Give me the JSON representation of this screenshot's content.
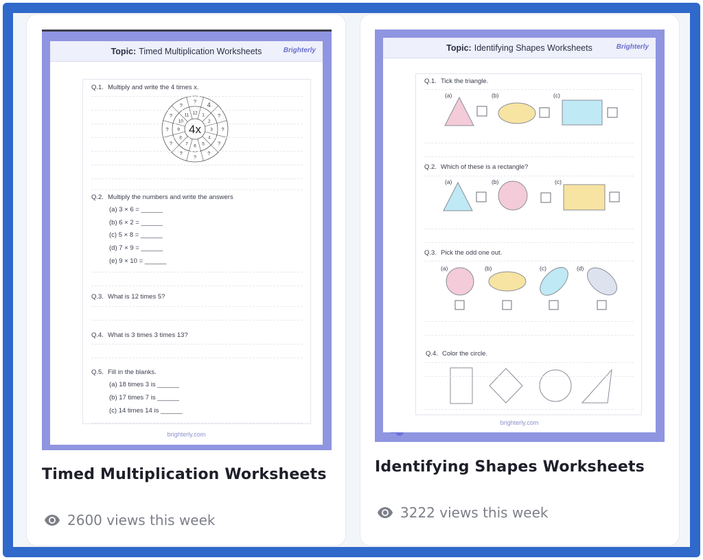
{
  "cards": [
    {
      "title": "Timed Multiplication Worksheets",
      "views": "2600 views this week",
      "sheet": {
        "topic_label": "Topic:",
        "topic": "Timed Multiplication Worksheets",
        "logo": "Brighterly",
        "footer": "brighterly.com",
        "questions": [
          {
            "num": "Q.1.",
            "text": "Multiply and write the 4 times x."
          },
          {
            "num": "Q.2.",
            "text": "Multiply the numbers and write the answers"
          },
          {
            "num": "Q.3.",
            "text": "What is 12 times 5?"
          },
          {
            "num": "Q.4.",
            "text": "What is 3 times 3 times 13?"
          },
          {
            "num": "Q.5.",
            "text": "Fill in the blanks."
          }
        ],
        "q2_items": [
          "(a) 3 × 6 = ______",
          "(b) 6 × 2 = ______",
          "(c) 5 × 8 = ______",
          "(d) 7 × 9 = ______",
          "(e) 9 × 10 = ______"
        ],
        "q5_items": [
          "(a) 18 times 3 is ______",
          "(b) 17 times 7 is ______",
          "(c) 14 times 14 is ______"
        ],
        "wheel": {
          "center": "4x",
          "inner": [
            "12",
            "1",
            "2",
            "3",
            "4",
            "5",
            "6",
            "7",
            "8",
            "9",
            "10",
            "11"
          ],
          "outer_mark": "?",
          "top_value": "4"
        }
      }
    },
    {
      "title": "Identifying Shapes Worksheets",
      "views": "3222 views this week",
      "sheet": {
        "topic_label": "Topic:",
        "topic": "Identifying Shapes Worksheets",
        "logo": "Brighterly",
        "footer": "brighterly.com",
        "questions": [
          {
            "num": "Q.1.",
            "text": "Tick the triangle."
          },
          {
            "num": "Q.2.",
            "text": "Which of these is a rectangle?"
          },
          {
            "num": "Q.3.",
            "text": "Pick the odd one out."
          },
          {
            "num": "Q.4.",
            "text": "Color the circle."
          }
        ],
        "option_labels": [
          "(a)",
          "(b)",
          "(c)",
          "(d)"
        ]
      }
    }
  ],
  "colors": {
    "frame": "#2f69c9",
    "ring": "#6a72d8",
    "sheet_bg": "#8f95e0",
    "pink": "#f4cbd8",
    "yellow": "#f7e4a2",
    "blue": "#bfe9f4",
    "gray": "#dde3ee"
  },
  "icons": {
    "views": "eye-icon"
  }
}
